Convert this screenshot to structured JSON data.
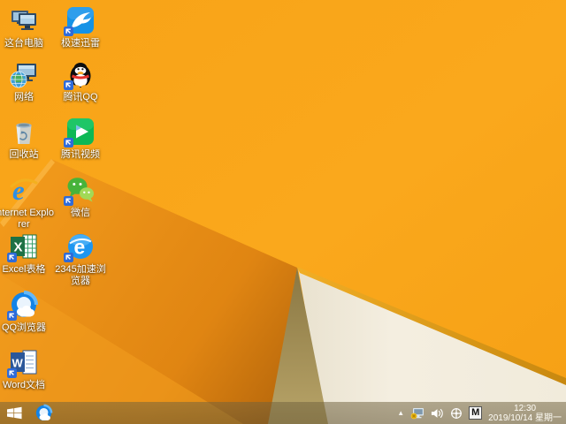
{
  "desktop": {
    "icons": [
      {
        "name": "this-pc",
        "label": "这台电脑",
        "shortcut": false
      },
      {
        "name": "xunlei-speed",
        "label": "极速迅雷",
        "shortcut": true
      },
      {
        "name": "network",
        "label": "网络",
        "shortcut": false
      },
      {
        "name": "tencent-qq",
        "label": "腾讯QQ",
        "shortcut": true
      },
      {
        "name": "recycle-bin",
        "label": "回收站",
        "shortcut": false
      },
      {
        "name": "tencent-video",
        "label": "腾讯视频",
        "shortcut": true
      },
      {
        "name": "internet-explorer",
        "label": "Internet Explorer",
        "shortcut": false
      },
      {
        "name": "wechat",
        "label": "微信",
        "shortcut": true
      },
      {
        "name": "excel",
        "label": "Excel表格",
        "shortcut": true
      },
      {
        "name": "browser-2345",
        "label": "2345加速浏览器",
        "shortcut": true
      },
      {
        "name": "qq-browser",
        "label": "QQ浏览器",
        "shortcut": true
      },
      {
        "name": "word",
        "label": "Word文档",
        "shortcut": true
      }
    ]
  },
  "taskbar": {
    "start": "start-button",
    "pinned": [
      {
        "name": "qq-browser"
      }
    ],
    "tray": {
      "icons": [
        "hidden-icons-arrow",
        "network-alert",
        "volume",
        "crosshair",
        "ime"
      ],
      "ime_letter": "M",
      "time": "12:30",
      "date": "2019/10/14 星期一"
    }
  },
  "wallpaper": {
    "theme": "windows-8.1-default-orange",
    "colors": {
      "base_orange": "#F8A519",
      "bright_orange": "#FBAC1E",
      "shadow_facet": "#C06C0E",
      "fold_olive": "#A08B52",
      "cream_fold": "#F2ECDC",
      "gold_edge": "#E7A81F"
    }
  }
}
